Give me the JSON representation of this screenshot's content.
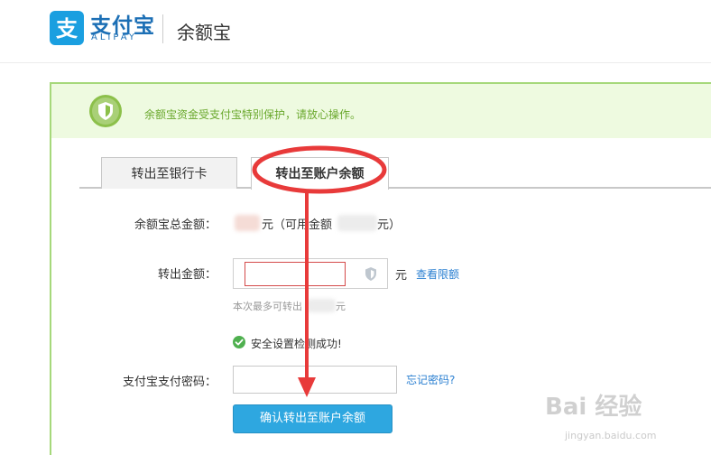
{
  "header": {
    "brand_cn": "支付宝",
    "brand_en": "ALIPAY",
    "product": "余额宝"
  },
  "notice": {
    "text": "余额宝资金受支付宝特别保护，请放心操作。"
  },
  "tabs": [
    {
      "label": "转出至银行卡",
      "active": false
    },
    {
      "label": "转出至账户余额",
      "active": true
    }
  ],
  "form": {
    "total_label": "余额宝总金额：",
    "total_prefix": "元（可用金额",
    "total_suffix": "元）",
    "amount_label": "转出金额：",
    "amount_value": "",
    "unit": "元",
    "limit_link": "查看限额",
    "max_hint_prefix": "本次最多可转出",
    "max_hint_suffix": "元",
    "security_check": "安全设置检测成功!",
    "password_label": "支付宝支付密码：",
    "password_value": "",
    "forgot_link": "忘记密码?",
    "confirm_button": "确认转出至账户余额"
  },
  "watermark": {
    "text": "Bai 经验",
    "sub": "jingyan.baidu.com"
  },
  "colors": {
    "brand_blue": "#1a9fe0",
    "panel_border": "#a6d87b",
    "notice_bg": "#eefae0",
    "annotation_red": "#e83a3a",
    "button_blue": "#2ea7e0"
  }
}
